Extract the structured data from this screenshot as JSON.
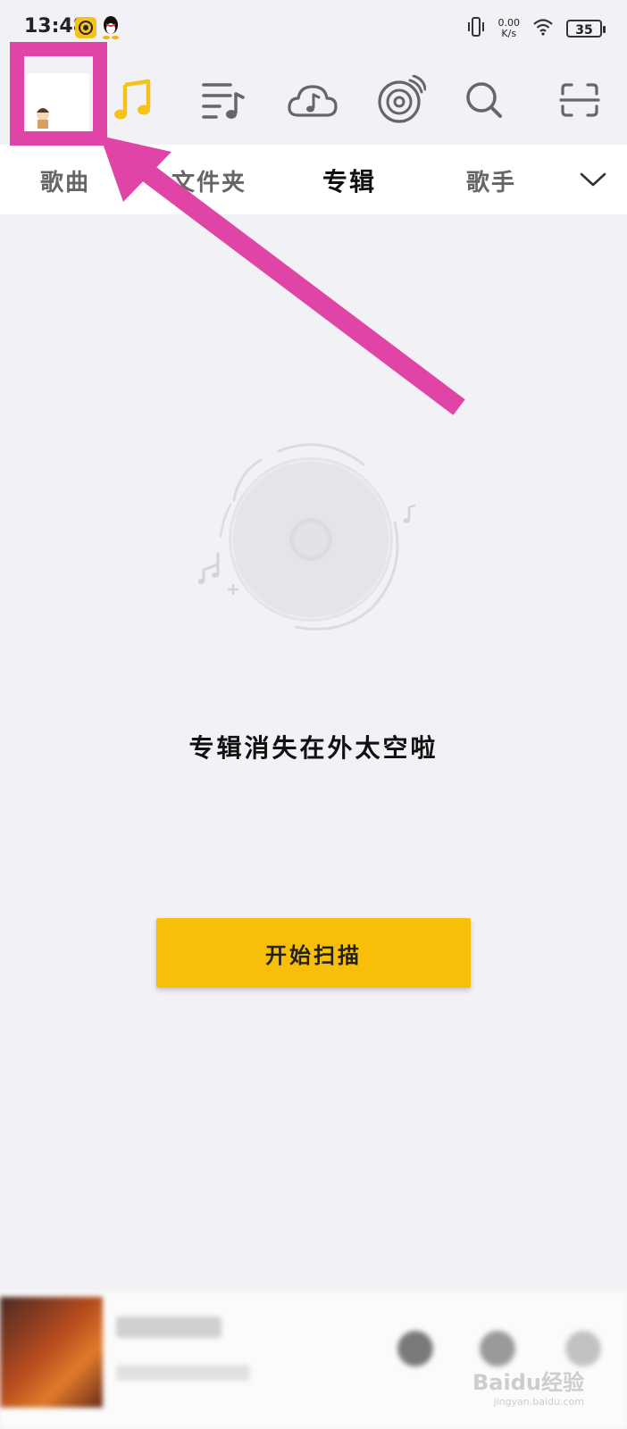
{
  "status_bar": {
    "time": "13:48",
    "net_speed_value": "0.00",
    "net_speed_unit": "K/s",
    "battery": "35"
  },
  "top_nav": {
    "icons": [
      "avatar",
      "music-note-icon",
      "playlist-icon",
      "cloud-music-icon",
      "radio-disc-icon",
      "search-icon",
      "scan-icon"
    ],
    "active_color": "#f5c21b"
  },
  "tabs": {
    "items": [
      "歌曲",
      "文件夹",
      "专辑",
      "歌手"
    ],
    "active_index": 2
  },
  "empty_state": {
    "message": "专辑消失在外太空啦",
    "scan_button_label": "开始扫描"
  },
  "watermark": {
    "brand": "Baidu经验",
    "domain": "jingyan.baidu.com"
  },
  "colors": {
    "accent": "#f8bf0a",
    "annotation": "#e044a6",
    "background": "#f2f1f6"
  }
}
